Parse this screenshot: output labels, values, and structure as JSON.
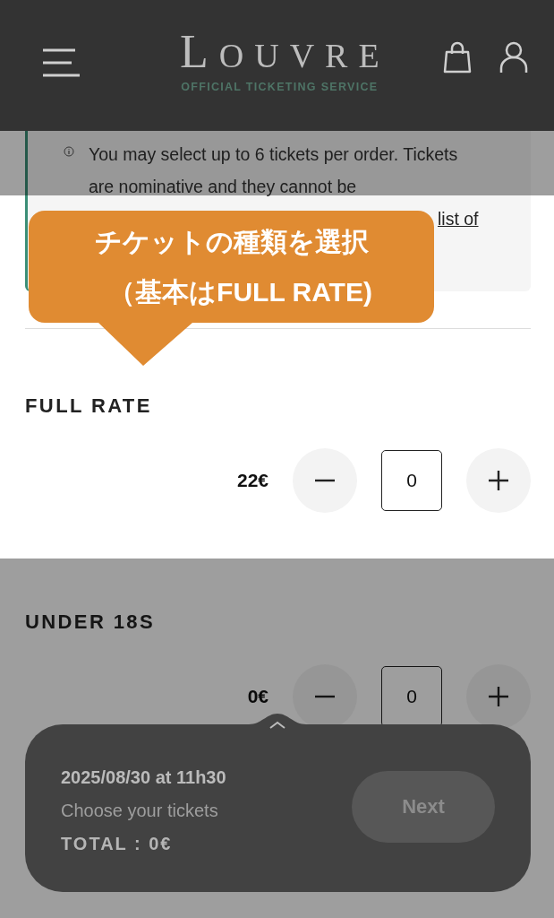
{
  "header": {
    "logo": "LOUVRE",
    "subtitle": "OFFICIAL TICKETING SERVICE"
  },
  "notice": {
    "text": "You may select up to 6 tickets per order. Tickets are nominative and they cannot be",
    "link": "list of"
  },
  "tickets": [
    {
      "name": "FULL RATE",
      "price": "22€",
      "quantity": "0"
    },
    {
      "name": "UNDER 18S",
      "price": "0€",
      "quantity": "0"
    }
  ],
  "callout": {
    "lines": [
      "チケットの種類を選択",
      "（基本はFULL RATE)"
    ]
  },
  "summary": {
    "date": "2025/08/30 at 11h30",
    "status": "Choose your tickets",
    "total": "TOTAL : 0€",
    "next_button": {
      "label": "Next",
      "disabled": true
    }
  }
}
